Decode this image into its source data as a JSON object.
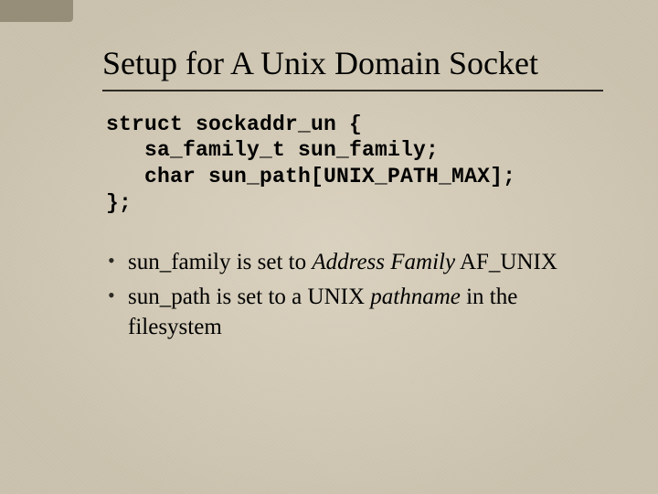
{
  "title": "Setup for A Unix Domain Socket",
  "code": {
    "l1": "struct sockaddr_un {",
    "l2": "   sa_family_t sun_family;",
    "l3": "   char sun_path[UNIX_PATH_MAX];",
    "l4": "};"
  },
  "bullets": {
    "b1a": "sun_family is set to ",
    "b1b": "Address Family",
    "b1c": " AF_UNIX",
    "b2a": "sun_path is set to a UNIX ",
    "b2b": "pathname",
    "b2c": " in the filesystem"
  }
}
